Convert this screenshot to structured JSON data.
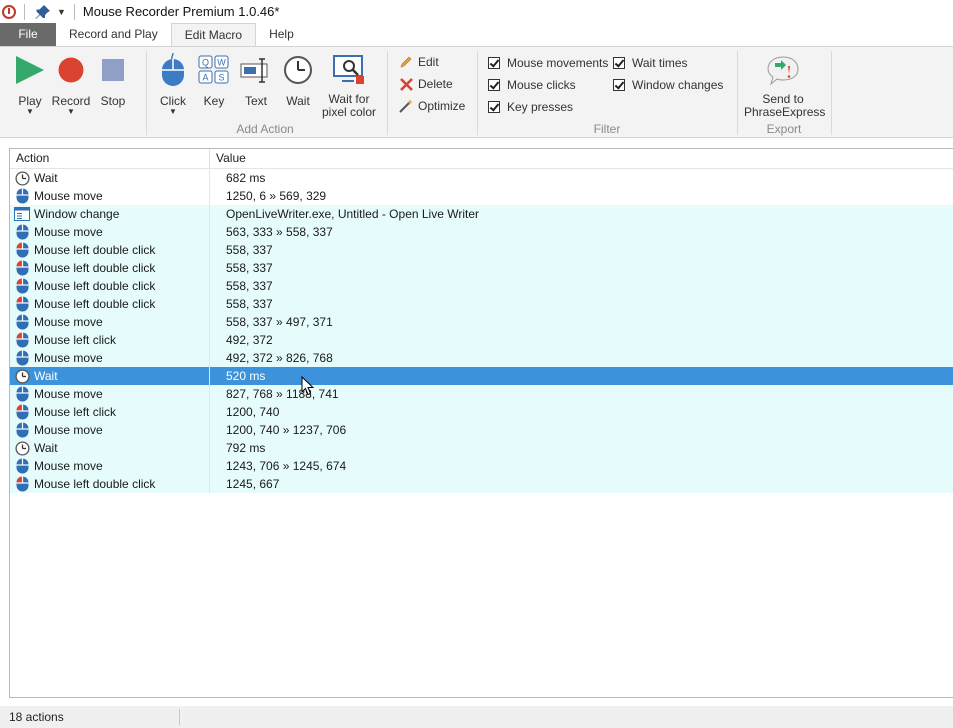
{
  "window": {
    "title": "Mouse Recorder Premium 1.0.46*"
  },
  "tabs": [
    {
      "label": "File"
    },
    {
      "label": "Record and Play"
    },
    {
      "label": "Edit Macro"
    },
    {
      "label": "Help"
    }
  ],
  "ribbon": {
    "play_label": "Play",
    "record_label": "Record",
    "stop_label": "Stop",
    "click_label": "Click",
    "key_label": "Key",
    "text_label": "Text",
    "wait_label": "Wait",
    "wait_pixel_label_1": "Wait for",
    "wait_pixel_label_2": "pixel color",
    "add_action_group": "Add Action",
    "edit_label": "Edit",
    "delete_label": "Delete",
    "optimize_label": "Optimize",
    "filter": {
      "mouse_movements": "Mouse movements",
      "mouse_clicks": "Mouse clicks",
      "key_presses": "Key presses",
      "wait_times": "Wait times",
      "window_changes": "Window changes"
    },
    "filter_group": "Filter",
    "send_label_1": "Send to",
    "send_label_2": "PhraseExpress",
    "export_group": "Export",
    "key_icon_letters": [
      "Q",
      "W",
      "A",
      "S"
    ]
  },
  "list": {
    "columns": {
      "action": "Action",
      "value": "Value"
    },
    "rows": [
      {
        "icon": "clock-icon",
        "action": "Wait",
        "value": "682 ms"
      },
      {
        "icon": "mouse-icon",
        "action": "Mouse move",
        "value": "1250, 6 » 569, 329"
      },
      {
        "icon": "window-icon",
        "action": "Window change",
        "value": "OpenLiveWriter.exe, Untitled - Open Live Writer"
      },
      {
        "icon": "mouse-icon",
        "action": "Mouse move",
        "value": "563, 333 » 558, 337"
      },
      {
        "icon": "mouse-left-icon",
        "action": "Mouse left double click",
        "value": "558, 337"
      },
      {
        "icon": "mouse-left-icon",
        "action": "Mouse left double click",
        "value": "558, 337"
      },
      {
        "icon": "mouse-left-icon",
        "action": "Mouse left double click",
        "value": "558, 337"
      },
      {
        "icon": "mouse-left-icon",
        "action": "Mouse left double click",
        "value": "558, 337"
      },
      {
        "icon": "mouse-icon",
        "action": "Mouse move",
        "value": "558, 337 » 497, 371"
      },
      {
        "icon": "mouse-left-icon",
        "action": "Mouse left click",
        "value": "492, 372"
      },
      {
        "icon": "mouse-icon",
        "action": "Mouse move",
        "value": "492, 372 » 826, 768"
      },
      {
        "icon": "clock-icon",
        "action": "Wait",
        "value": "520 ms",
        "selected": true
      },
      {
        "icon": "mouse-icon",
        "action": "Mouse move",
        "value": "827, 768 » 1188, 741"
      },
      {
        "icon": "mouse-left-icon",
        "action": "Mouse left click",
        "value": "1200, 740"
      },
      {
        "icon": "mouse-icon",
        "action": "Mouse move",
        "value": "1200, 740 » 1237, 706"
      },
      {
        "icon": "clock-icon",
        "action": "Wait",
        "value": "792 ms"
      },
      {
        "icon": "mouse-icon",
        "action": "Mouse move",
        "value": "1243, 706 » 1245, 674"
      },
      {
        "icon": "mouse-left-icon",
        "action": "Mouse left double click",
        "value": "1245, 667"
      }
    ]
  },
  "status": {
    "text": "18 actions"
  },
  "colors": {
    "selection": "#3c93dc",
    "row_alt": "#e6fbfb",
    "play": "#35a86b",
    "record": "#d9432f",
    "stop": "#8f9fc6",
    "mouse": "#2e6fb5"
  }
}
